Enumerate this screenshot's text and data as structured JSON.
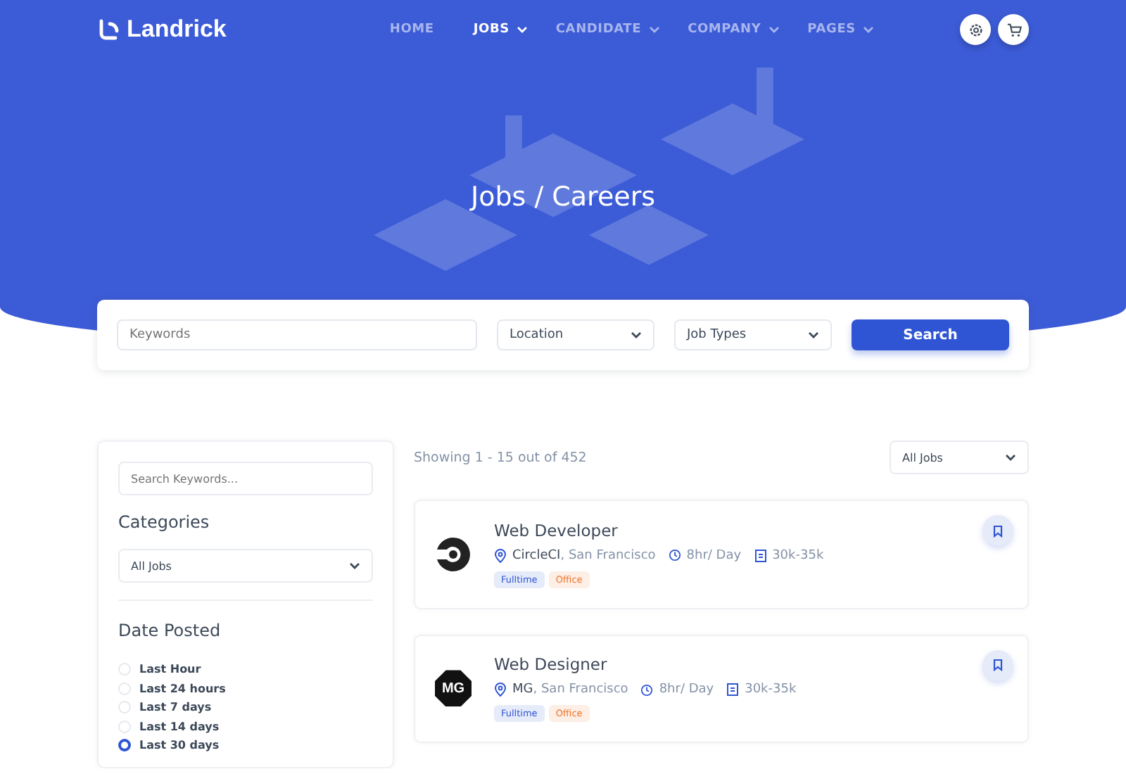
{
  "brand": "Landrick",
  "nav": [
    {
      "label": "HOME",
      "selected": false,
      "dropdown": false
    },
    {
      "label": "JOBS",
      "selected": true,
      "dropdown": true
    },
    {
      "label": "CANDIDATE",
      "selected": false,
      "dropdown": true
    },
    {
      "label": "COMPANY",
      "selected": false,
      "dropdown": true
    },
    {
      "label": "PAGES",
      "selected": false,
      "dropdown": true
    }
  ],
  "hero_title": "Jobs / Careers",
  "search": {
    "keywords_placeholder": "Keywords",
    "location": "Location",
    "job_types": "Job Types",
    "button": "Search"
  },
  "sidebar": {
    "search_placeholder": "Search Keywords...",
    "categories_title": "Categories",
    "category": "All Jobs",
    "date_title": "Date Posted",
    "dates": [
      {
        "label": "Last Hour",
        "selected": false
      },
      {
        "label": "Last 24 hours",
        "selected": false
      },
      {
        "label": "Last 7 days",
        "selected": false
      },
      {
        "label": "Last 14 days",
        "selected": false
      },
      {
        "label": "Last 30 days",
        "selected": true
      }
    ]
  },
  "results": {
    "summary": "Showing 1 - 15 out of 452",
    "filter": "All Jobs"
  },
  "jobs": [
    {
      "logo": {
        "kind": "ring"
      },
      "title": "Web Developer",
      "location": "**CircleCI**, San Francisco",
      "hours": "8hr/ Day",
      "salary": "30k-35k",
      "tags": [
        {
          "label": "Fulltime",
          "kind": "type"
        },
        {
          "label": "Office",
          "kind": "place"
        }
      ]
    },
    {
      "logo": {
        "kind": "octagon",
        "text": "MG"
      },
      "title": "Web Designer",
      "location": "**MG**, San Francisco",
      "hours": "8hr/ Day",
      "salary": "30k-35k",
      "tags": [
        {
          "label": "Fulltime",
          "kind": "type"
        },
        {
          "label": "Office",
          "kind": "place"
        }
      ]
    }
  ]
}
